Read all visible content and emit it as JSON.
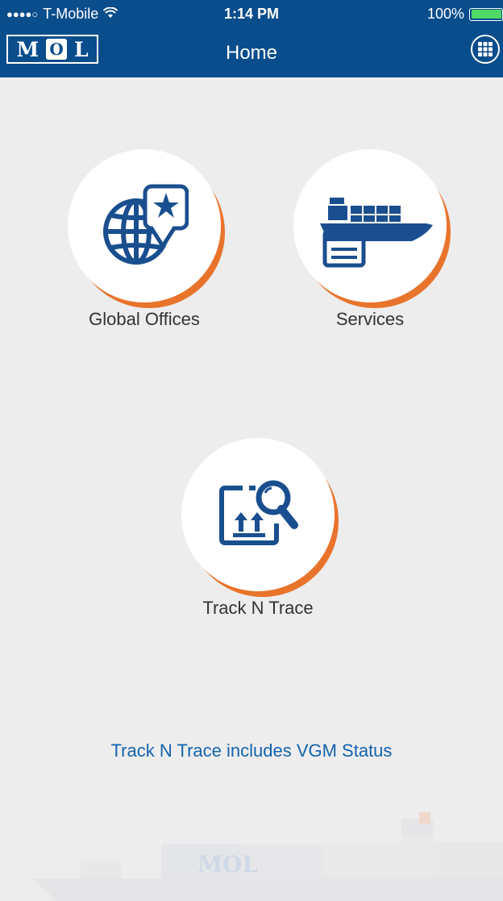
{
  "status_bar": {
    "carrier": "T-Mobile",
    "time": "1:14 PM",
    "battery": "100%",
    "icons": [
      "signal-dots-icon",
      "wifi-icon",
      "battery-icon"
    ]
  },
  "nav": {
    "logo_text": [
      "M",
      "O",
      "L"
    ],
    "title": "Home",
    "menu_icon": "grid-menu-icon"
  },
  "tiles": [
    {
      "label": "Global Offices",
      "icon": "globe-pin-icon"
    },
    {
      "label": "Services",
      "icon": "ship-schedule-icon"
    },
    {
      "label": "Track N Trace",
      "icon": "container-search-icon"
    }
  ],
  "promo_text": "Track N Trace includes VGM Status",
  "background": {
    "ship_logo": "MOL"
  },
  "colors": {
    "header": "#0a4d8c",
    "accent": "#e8742c",
    "icon": "#1a4f8f",
    "link": "#1463ad",
    "background": "#ededee"
  }
}
